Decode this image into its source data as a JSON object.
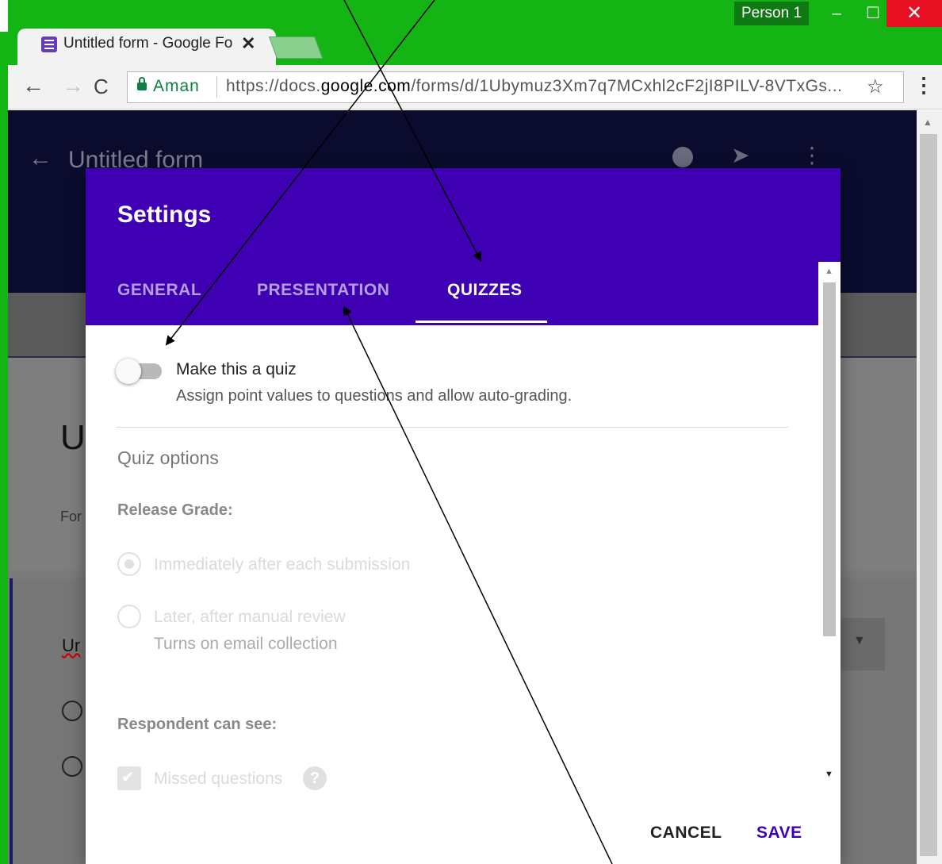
{
  "browser": {
    "profile": "Person 1",
    "tab_title": "Untitled form - Google Fo",
    "tab_close": "✕",
    "secure_label": "Aman",
    "url_prefix": "https://docs.",
    "url_domain": "google.com",
    "url_rest": "/forms/d/1Ubymuz3Xm7q7MCxhl2cF2jI8PILV-8VTxGs...",
    "window_controls": {
      "minimize": "‒",
      "maximize": "☐",
      "close": "✕"
    }
  },
  "page": {
    "header_title": "Untitled form",
    "bg_text_u": "U",
    "bg_text_for": "For",
    "bg_text_un": "Ur"
  },
  "dialog": {
    "title": "Settings",
    "tabs": {
      "general": "GENERAL",
      "presentation": "PRESENTATION",
      "quizzes": "QUIZZES"
    },
    "quiz_toggle": {
      "title": "Make this a quiz",
      "description": "Assign point values to questions and allow auto-grading.",
      "state": "off"
    },
    "quiz_options_title": "Quiz options",
    "release_grade": {
      "label": "Release Grade:",
      "option_immediate": "Immediately after each submission",
      "option_later": "Later, after manual review",
      "option_later_sub": "Turns on email collection"
    },
    "respondent": {
      "label": "Respondent can see:",
      "missed_questions": "Missed questions"
    },
    "buttons": {
      "cancel": "CANCEL",
      "save": "SAVE"
    }
  },
  "icons": {
    "back": "arrow-left-icon",
    "forward": "arrow-right-icon",
    "reload": "reload-icon",
    "star": "star-icon",
    "menu": "kebab-menu-icon",
    "help": "help-icon"
  },
  "colors": {
    "dialog_header": "#3f00b4",
    "window_frame": "#14b414",
    "close_button": "#e81123"
  }
}
